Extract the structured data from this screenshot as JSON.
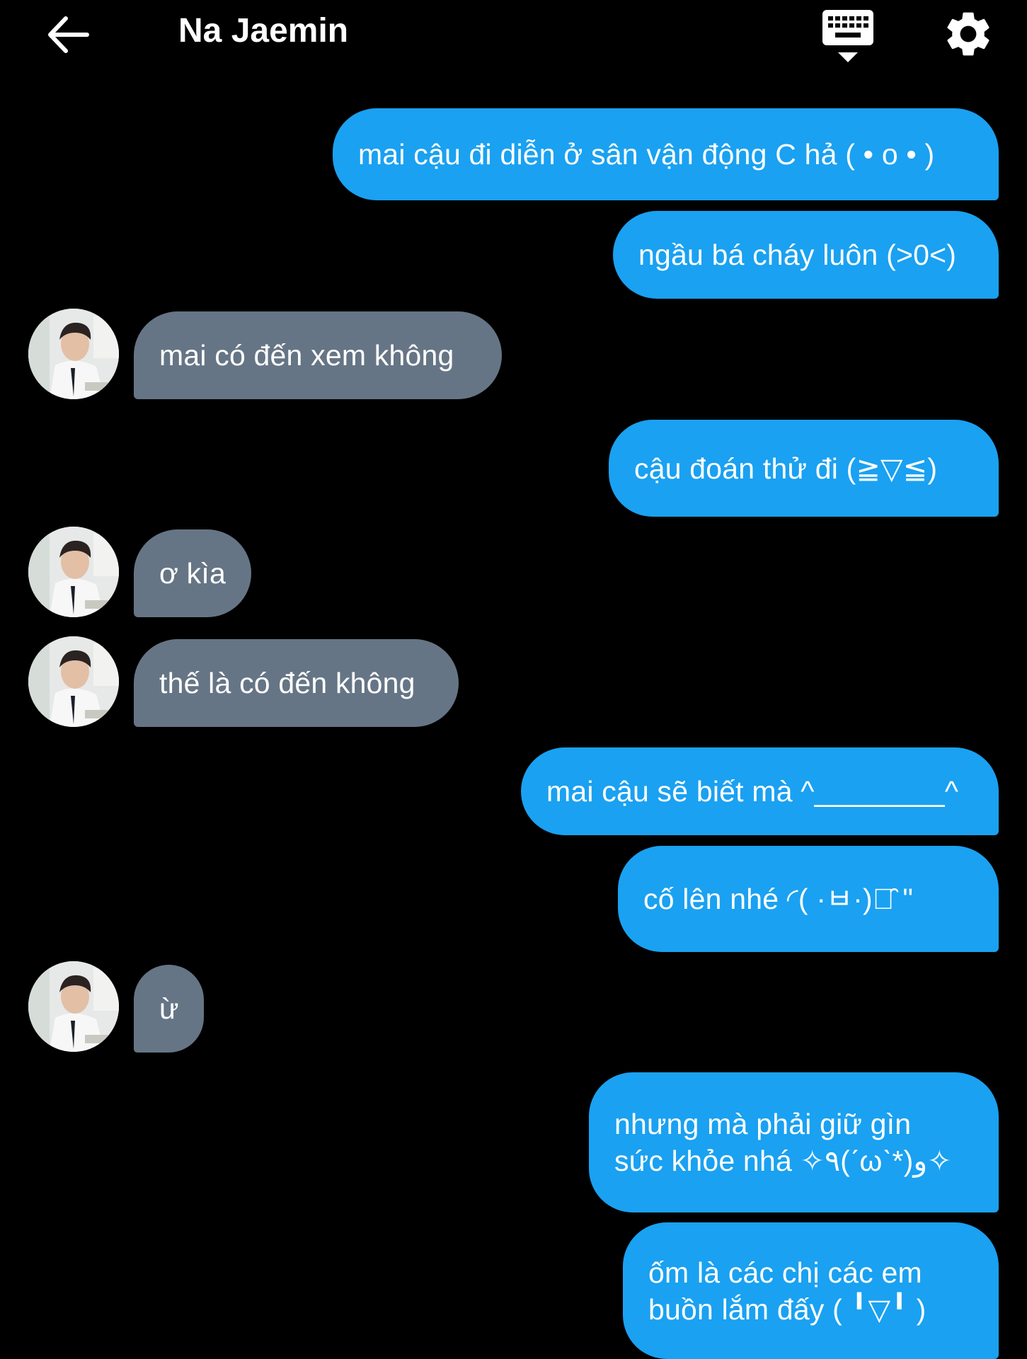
{
  "header": {
    "title": "Na Jaemin",
    "back_icon": "arrow-left-icon",
    "keyboard_icon": "keyboard-hide-icon",
    "settings_icon": "gear-icon"
  },
  "colors": {
    "background": "#000000",
    "sent_bubble": "#1aa1f1",
    "received_bubble": "#667585",
    "text": "#ffffff"
  },
  "messages": [
    {
      "sender": "me",
      "text": "mai cậu đi diễn ở sân vận động C hả ( • o • )"
    },
    {
      "sender": "me",
      "text": "ngầu bá cháy luôn (>0<)"
    },
    {
      "sender": "other",
      "text": "mai có đến xem không"
    },
    {
      "sender": "me",
      "text": "cậu đoán thử đi (≧▽≦)"
    },
    {
      "sender": "other",
      "text": "ơ kìa"
    },
    {
      "sender": "other",
      "text": "thế là có đến không"
    },
    {
      "sender": "me",
      "text": "mai cậu sẽ biết mà ^________^"
    },
    {
      "sender": "me",
      "text": "cố lên nhé  ◜( ·ㅂ·)ง̑̑  \""
    },
    {
      "sender": "other",
      "text": "ừ"
    },
    {
      "sender": "me",
      "lines": [
        "nhưng mà phải giữ gìn",
        "sức khỏe nhá ✧٩(ˊωˋ*)و✧"
      ]
    },
    {
      "sender": "me",
      "lines": [
        "ốm là các chị các em",
        "buồn lắm đấy ( ╹▽╹ )"
      ]
    }
  ]
}
